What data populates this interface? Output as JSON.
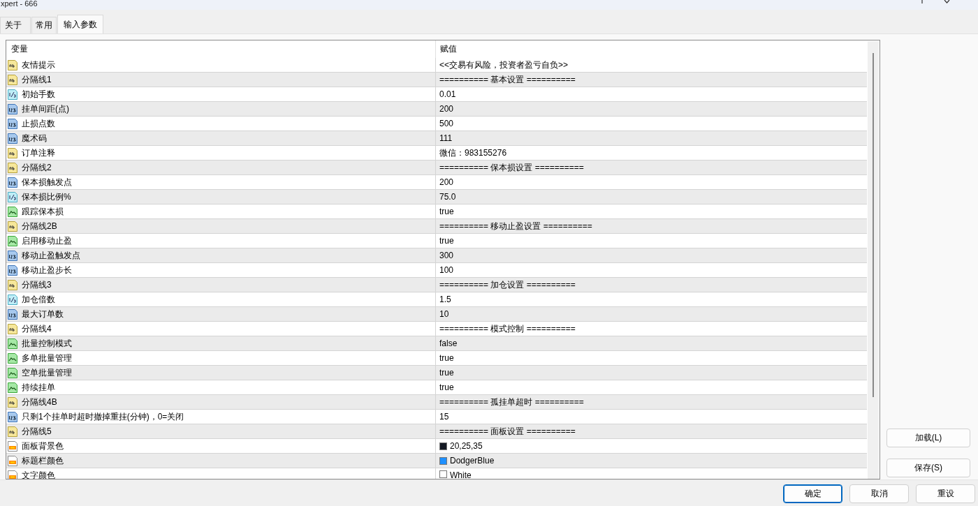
{
  "window": {
    "title": "xpert - 666"
  },
  "tabs": [
    {
      "label": "关于",
      "selected": false
    },
    {
      "label": "常用",
      "selected": false
    },
    {
      "label": "输入参数",
      "selected": true
    }
  ],
  "table": {
    "columns": [
      "变量",
      "赋值"
    ],
    "rows": [
      {
        "kind": "string",
        "name": "友情提示",
        "value": "<<交易有风险，投资者盈亏自负>>"
      },
      {
        "kind": "string",
        "name": "分隔线1",
        "value": "========== 基本设置 =========="
      },
      {
        "kind": "double",
        "name": "初始手数",
        "value": "0.01"
      },
      {
        "kind": "int",
        "name": "挂单间距(点)",
        "value": "200"
      },
      {
        "kind": "int",
        "name": "止损点数",
        "value": "500"
      },
      {
        "kind": "int",
        "name": "魔术码",
        "value": "111"
      },
      {
        "kind": "string",
        "name": "订单注释",
        "value": "微信：983155276"
      },
      {
        "kind": "string",
        "name": "分隔线2",
        "value": "========== 保本损设置 =========="
      },
      {
        "kind": "int",
        "name": "保本损触发点",
        "value": "200"
      },
      {
        "kind": "double",
        "name": "保本损比例%",
        "value": "75.0"
      },
      {
        "kind": "bool",
        "name": "跟踪保本损",
        "value": "true"
      },
      {
        "kind": "string",
        "name": "分隔线2B",
        "value": "========== 移动止盈设置 =========="
      },
      {
        "kind": "bool",
        "name": "启用移动止盈",
        "value": "true"
      },
      {
        "kind": "int",
        "name": "移动止盈触发点",
        "value": "300"
      },
      {
        "kind": "int",
        "name": "移动止盈步长",
        "value": "100"
      },
      {
        "kind": "string",
        "name": "分隔线3",
        "value": "========== 加仓设置 =========="
      },
      {
        "kind": "double",
        "name": "加仓倍数",
        "value": "1.5"
      },
      {
        "kind": "int",
        "name": "最大订单数",
        "value": "10"
      },
      {
        "kind": "string",
        "name": "分隔线4",
        "value": "========== 模式控制 =========="
      },
      {
        "kind": "bool",
        "name": "批量控制模式",
        "value": "false"
      },
      {
        "kind": "bool",
        "name": "多单批量管理",
        "value": "true"
      },
      {
        "kind": "bool",
        "name": "空单批量管理",
        "value": "true"
      },
      {
        "kind": "bool",
        "name": "持续挂单",
        "value": "true"
      },
      {
        "kind": "string",
        "name": "分隔线4B",
        "value": "========== 孤挂单超时 =========="
      },
      {
        "kind": "int",
        "name": "只剩1个挂单时超时撤掉重挂(分钟)，0=关闭",
        "value": "15"
      },
      {
        "kind": "string",
        "name": "分隔线5",
        "value": "========== 面板设置 =========="
      },
      {
        "kind": "color",
        "name": "面板背景色",
        "value": "20,25,35",
        "color": "#141923"
      },
      {
        "kind": "color",
        "name": "标题栏颜色",
        "value": "DodgerBlue",
        "color": "#1e90ff"
      },
      {
        "kind": "color",
        "name": "文字颜色",
        "value": "White",
        "color": "#ffffff"
      }
    ]
  },
  "side_buttons": [
    "加载(L)",
    "保存(S)"
  ],
  "buttons": [
    {
      "label": "确定",
      "default": true
    },
    {
      "label": "取消",
      "default": false
    },
    {
      "label": "重设",
      "default": false
    }
  ]
}
